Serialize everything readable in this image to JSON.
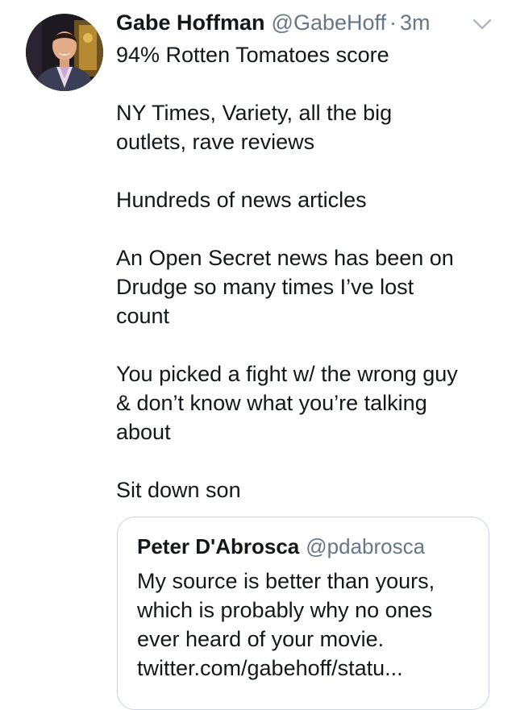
{
  "tweet": {
    "author_name": "Gabe Hoffman",
    "author_handle": "@GabeHoff",
    "separator": "·",
    "time": "3m",
    "icons": {
      "avatar": "profile-photo",
      "menu": "chevron-down-icon"
    },
    "paragraphs": [
      [
        "94% Rotten Tomatoes score"
      ],
      [
        "NY Times, Variety, all the big",
        "outlets, rave reviews"
      ],
      [
        "Hundreds of news articles"
      ],
      [
        "An Open Secret news has been on",
        "Drudge so many times I’ve lost",
        "count"
      ],
      [
        "You picked a fight w/ the wrong guy",
        "& don’t know what you’re talking",
        "about"
      ],
      [
        "Sit down son"
      ]
    ]
  },
  "quote": {
    "author_name": "Peter D'Abrosca",
    "author_handle": "@pdabrosca",
    "lines": [
      "My source is better than yours,",
      "which is probably why no ones",
      "ever heard of your movie.",
      "twitter.com/gabehoff/statu..."
    ]
  },
  "colors": {
    "text": "#14171a",
    "secondary": "#657786",
    "border": "#ccd6dd",
    "background": "#ffffff"
  }
}
